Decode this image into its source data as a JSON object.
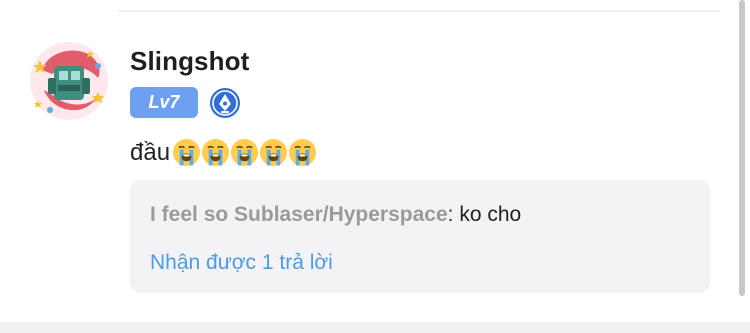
{
  "comment": {
    "username": "Slingshot",
    "level": "Lv7",
    "role_icon": "pen-nib-badge-icon",
    "message_text": "đầu",
    "emojis": [
      "loudly-crying-face-icon",
      "loudly-crying-face-icon",
      "loudly-crying-face-icon",
      "loudly-crying-face-icon",
      "loudly-crying-face-icon"
    ],
    "avatar": "avatar-robot-sticker"
  },
  "quote": {
    "author": "I feel so Sublaser/Hyperspace",
    "separator": ": ",
    "text": "ko cho",
    "reply_link": "Nhận được 1 trả lời"
  },
  "colors": {
    "level_badge": "#6e9ff0",
    "role_icon": "#2f6fd6",
    "link": "#4a9be8",
    "quote_bg": "#f3f3f5"
  }
}
